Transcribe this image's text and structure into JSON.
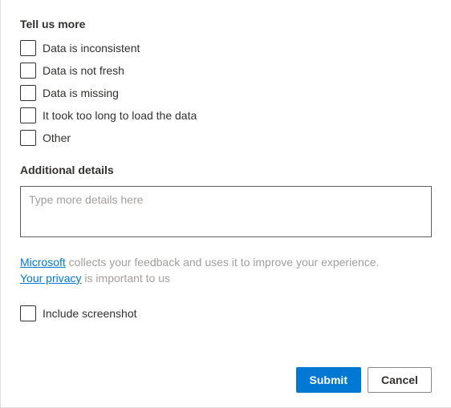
{
  "headings": {
    "tell_us_more": "Tell us more",
    "additional_details": "Additional details"
  },
  "checkboxes": {
    "items": [
      {
        "label": "Data is inconsistent"
      },
      {
        "label": "Data is not fresh"
      },
      {
        "label": "Data is missing"
      },
      {
        "label": "It took too long to load the data"
      },
      {
        "label": "Other"
      }
    ]
  },
  "textarea": {
    "placeholder": "Type more details here",
    "value": ""
  },
  "legal": {
    "link1": "Microsoft",
    "text1": " collects your feedback and uses it to improve your experience. ",
    "link2": "Your privacy",
    "text2": " is important to us"
  },
  "include_screenshot": {
    "label": "Include screenshot"
  },
  "buttons": {
    "submit": "Submit",
    "cancel": "Cancel"
  }
}
